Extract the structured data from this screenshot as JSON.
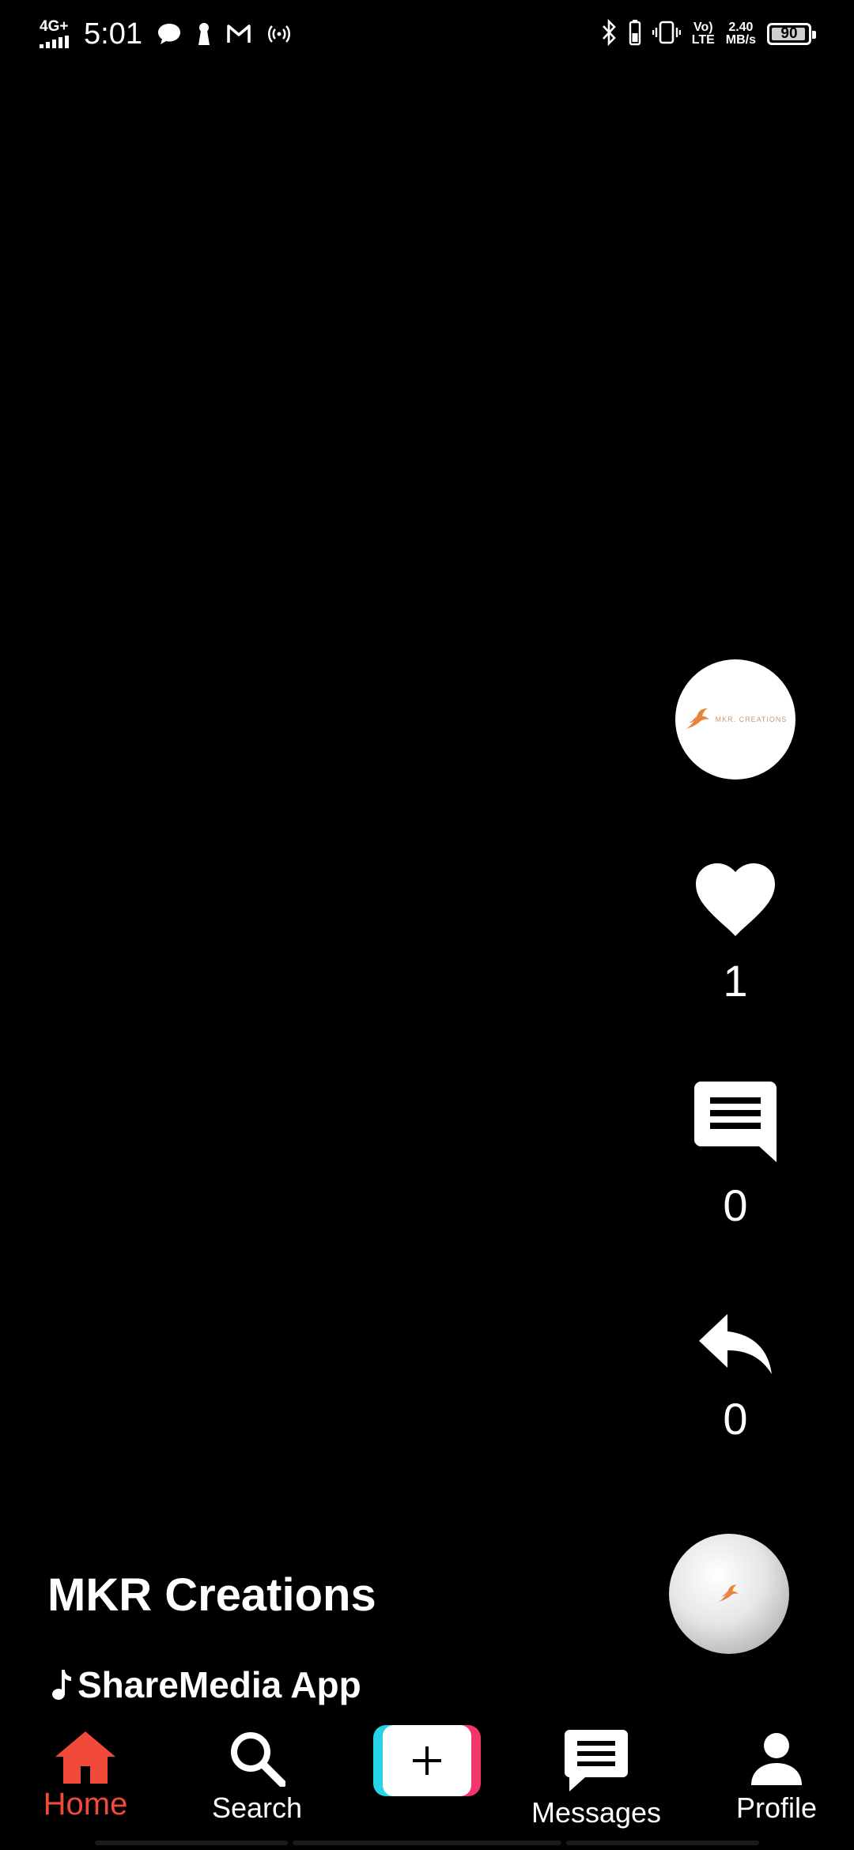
{
  "status_bar": {
    "network": "4G+",
    "time": "5:01",
    "volte": [
      "Vo)",
      "LTE"
    ],
    "speed": [
      "2.40",
      "MB/s"
    ],
    "battery": "90"
  },
  "actions": {
    "likes": "1",
    "comments": "0",
    "shares": "0"
  },
  "creator": {
    "avatar_brand": "MKR. CREATIONS"
  },
  "caption": {
    "username": "MKR Creations",
    "music": "ShareMedia App"
  },
  "nav": {
    "home": "Home",
    "search": "Search",
    "messages": "Messages",
    "profile": "Profile"
  },
  "colors": {
    "background": "#000000",
    "active_tab": "#f24a3a",
    "create_cyan": "#27d3e6",
    "create_pink": "#f2356a"
  }
}
